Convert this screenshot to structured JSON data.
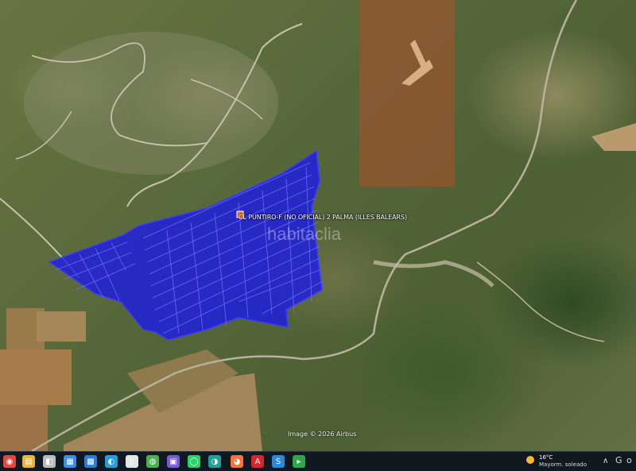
{
  "map": {
    "parcel_label": "CL PUNTIRO-F (NO OFICIAL) 2 PALMA (ILLES BALEARS)",
    "watermark": "habitaclia",
    "imagery_credit": "Image © 2026 Airbus",
    "parcel_color": "#1a1ae6",
    "highlight_color": "#a0522d"
  },
  "taskbar": {
    "icons": [
      {
        "name": "start-icon",
        "glyph": "◉",
        "color": "#e8453c"
      },
      {
        "name": "file-explorer-icon",
        "glyph": "▤",
        "color": "#e9b43a"
      },
      {
        "name": "app-icon",
        "glyph": "◧",
        "color": "#bbbbbb"
      },
      {
        "name": "files-icon",
        "glyph": "▦",
        "color": "#3a8ee9"
      },
      {
        "name": "photos-icon",
        "glyph": "▩",
        "color": "#2a7cd6"
      },
      {
        "name": "edge-icon",
        "glyph": "◐",
        "color": "#1fa0d8"
      },
      {
        "name": "document-icon",
        "glyph": "▯",
        "color": "#e5e5e5"
      },
      {
        "name": "chrome-icon",
        "glyph": "◍",
        "color": "#4caf50"
      },
      {
        "name": "save-icon",
        "glyph": "▣",
        "color": "#7a5ad8"
      },
      {
        "name": "whatsapp-icon",
        "glyph": "◯",
        "color": "#25d366"
      },
      {
        "name": "edge-dev-icon",
        "glyph": "◑",
        "color": "#1aa39a"
      },
      {
        "name": "firefox-icon",
        "glyph": "◕",
        "color": "#ff7139"
      },
      {
        "name": "acrobat-icon",
        "glyph": "A",
        "color": "#d8262d"
      },
      {
        "name": "s-app-icon",
        "glyph": "S",
        "color": "#2a8ad8"
      },
      {
        "name": "mail-icon",
        "glyph": "▸",
        "color": "#2aa84a"
      }
    ],
    "weather_temp": "16°C",
    "weather_desc": "Mayorm. soleado",
    "tray_glyph_1": "∧",
    "tray_glyph_2": "G",
    "tray_glyph_3": "o"
  }
}
